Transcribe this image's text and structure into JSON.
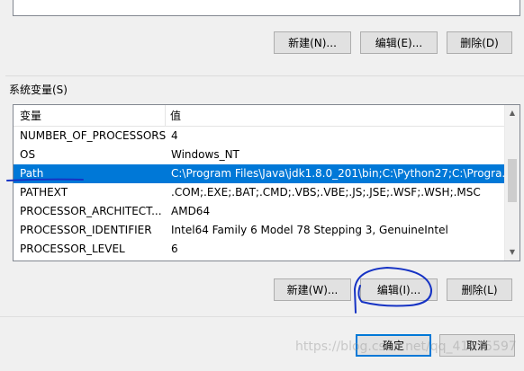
{
  "user_vars": {
    "buttons": {
      "new": "新建(N)...",
      "edit": "编辑(E)...",
      "delete": "删除(D)"
    }
  },
  "system_vars": {
    "label": "系统变量(S)",
    "columns": {
      "name": "变量",
      "value": "值"
    },
    "rows": [
      {
        "name": "NUMBER_OF_PROCESSORS",
        "value": "4",
        "selected": false
      },
      {
        "name": "OS",
        "value": "Windows_NT",
        "selected": false
      },
      {
        "name": "Path",
        "value": "C:\\Program Files\\Java\\jdk1.8.0_201\\bin;C:\\Python27;C:\\Progra...",
        "selected": true
      },
      {
        "name": "PATHEXT",
        "value": ".COM;.EXE;.BAT;.CMD;.VBS;.VBE;.JS;.JSE;.WSF;.WSH;.MSC",
        "selected": false
      },
      {
        "name": "PROCESSOR_ARCHITECT...",
        "value": "AMD64",
        "selected": false
      },
      {
        "name": "PROCESSOR_IDENTIFIER",
        "value": "Intel64 Family 6 Model 78 Stepping 3, GenuineIntel",
        "selected": false
      },
      {
        "name": "PROCESSOR_LEVEL",
        "value": "6",
        "selected": false
      }
    ],
    "buttons": {
      "new": "新建(W)...",
      "edit": "编辑(I)...",
      "delete": "删除(L)"
    }
  },
  "dialog": {
    "ok": "确定",
    "cancel": "取消"
  },
  "watermark": "https://blog.csdn.net/qq_41615597",
  "colors": {
    "selection": "#0078d7",
    "annotation_ink": "#1633c4"
  }
}
